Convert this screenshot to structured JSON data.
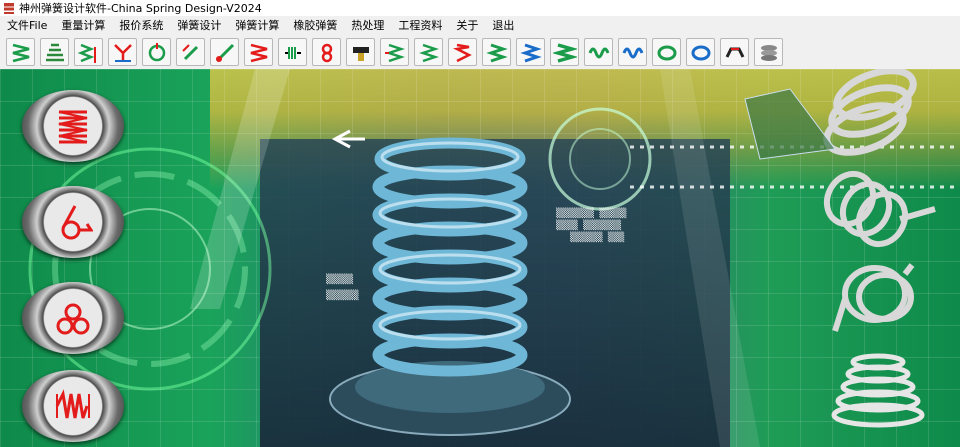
{
  "window": {
    "title": "神州弹簧设计软件-China Spring Design-V2024"
  },
  "menu": {
    "items": [
      {
        "label": "文件File"
      },
      {
        "label": "重量计算"
      },
      {
        "label": "报价系统"
      },
      {
        "label": "弹簧设计"
      },
      {
        "label": "弹簧计算"
      },
      {
        "label": "橡胶弹簧"
      },
      {
        "label": "热处理"
      },
      {
        "label": "工程资料"
      },
      {
        "label": "关于"
      },
      {
        "label": "退出"
      }
    ]
  },
  "toolbar": {
    "buttons": [
      {
        "icon": "compression-spring-green-icon"
      },
      {
        "icon": "conical-spring-icon"
      },
      {
        "icon": "spring-weight-icon"
      },
      {
        "icon": "spring-force-y-icon"
      },
      {
        "icon": "wire-form-icon"
      },
      {
        "icon": "bend-arrow-icon"
      },
      {
        "icon": "diagonal-tool-icon"
      },
      {
        "icon": "red-spring-icon"
      },
      {
        "icon": "extension-spring-icon"
      },
      {
        "icon": "torsion-double-icon"
      },
      {
        "icon": "flat-tool-icon"
      },
      {
        "icon": "spring-load-icon"
      },
      {
        "icon": "spring-plain-icon"
      },
      {
        "icon": "spring-pitch-icon"
      },
      {
        "icon": "spring-green-icon"
      },
      {
        "icon": "spring-blue-icon"
      },
      {
        "icon": "spring-coil-icon"
      },
      {
        "icon": "coil-horizontal-icon"
      },
      {
        "icon": "blue-coil-horizontal-icon"
      },
      {
        "icon": "ring-green-icon"
      },
      {
        "icon": "ring-blue-icon"
      },
      {
        "icon": "clip-icon"
      },
      {
        "icon": "disc-stack-icon"
      }
    ]
  },
  "left_buttons": [
    {
      "icon": "compression-spring-icon"
    },
    {
      "icon": "torsion-spring-icon"
    },
    {
      "icon": "double-torsion-spring-icon"
    },
    {
      "icon": "extension-spring-icon"
    }
  ],
  "colors": {
    "accent_red": "#e31b1b",
    "accent_green": "#1a9c4a",
    "spring_blue": "#5fa8c9"
  }
}
